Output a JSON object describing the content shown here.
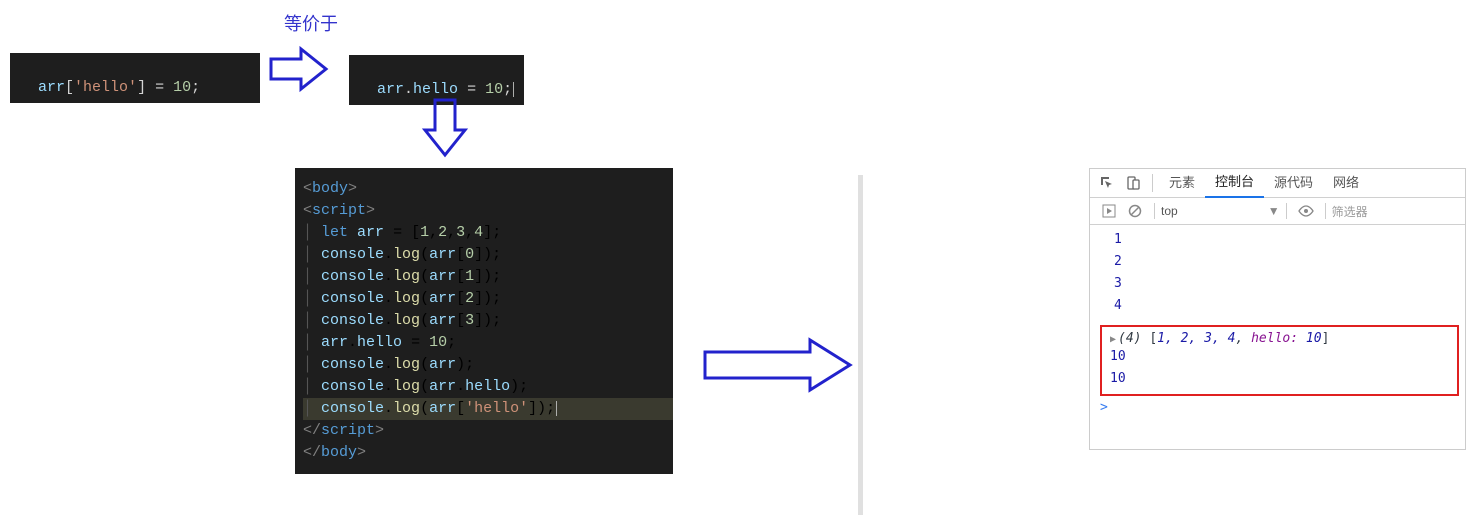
{
  "label_equiv": "等价于",
  "code_left": {
    "var": "arr",
    "bracket_open": "[",
    "str": "'hello'",
    "bracket_close": "]",
    "eq": " = ",
    "num": "10",
    "semi": ";"
  },
  "code_right": {
    "var": "arr",
    "dot": ".",
    "prop": "hello",
    "eq": " = ",
    "num": "10",
    "semi": ";"
  },
  "code_block": {
    "l1_open": "<",
    "l1_tag": "body",
    "l1_close": ">",
    "l2_open": "<",
    "l2_tag": "script",
    "l2_close": ">",
    "l3": "let arr = [1,2,3,4];",
    "l4": "console.log(arr[0]);",
    "l5": "console.log(arr[1]);",
    "l6": "console.log(arr[2]);",
    "l7": "console.log(arr[3]);",
    "l8": "",
    "l9": "arr.hello = 10;",
    "l10": "console.log(arr);",
    "l11": "console.log(arr.hello);",
    "l12": "console.log(arr['hello']);",
    "l13_open": "</",
    "l13_tag": "script",
    "l13_close": ">",
    "l14_open": "</",
    "l14_tag": "body",
    "l14_close": ">"
  },
  "devtools": {
    "tabs": {
      "elements": "元素",
      "console": "控制台",
      "sources": "源代码",
      "network": "网络"
    },
    "top": "top",
    "filter": "筛选器",
    "rows": [
      "1",
      "2",
      "3",
      "4"
    ],
    "arr_len": "(4)",
    "arr_vals": "1, 2, 3, 4",
    "arr_prop": "hello:",
    "arr_prop_val": "10",
    "out1": "10",
    "out2": "10",
    "prompt": ">"
  }
}
